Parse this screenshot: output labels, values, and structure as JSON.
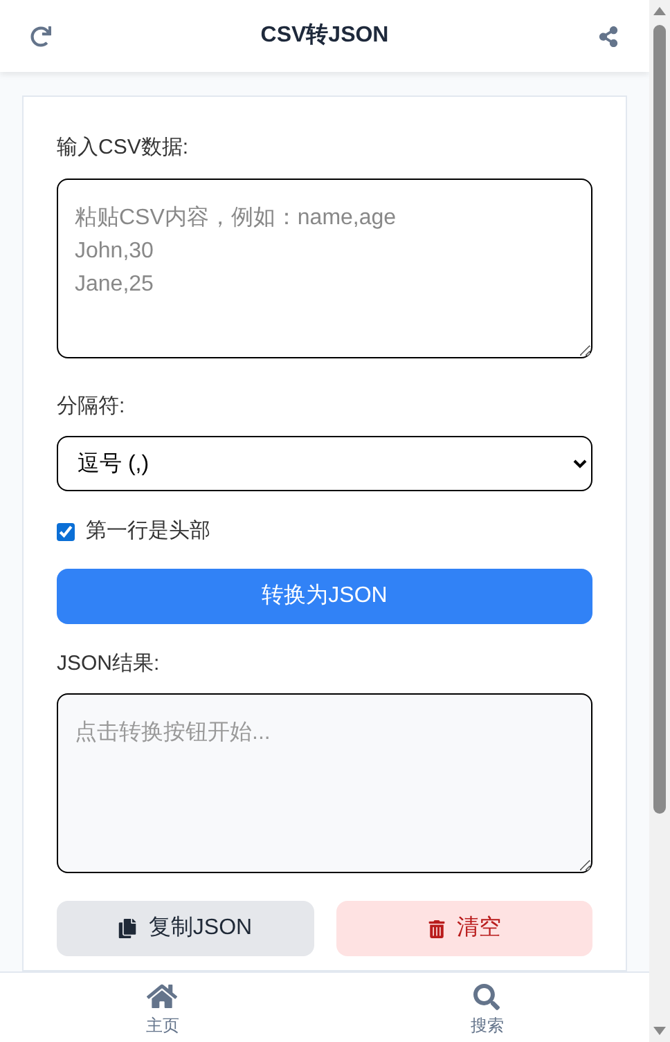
{
  "header": {
    "title": "CSV转JSON"
  },
  "input": {
    "label": "输入CSV数据:",
    "placeholder": "粘贴CSV内容，例如：name,age\nJohn,30\nJane,25"
  },
  "delimiter": {
    "label": "分隔符:",
    "value": "逗号 (,)"
  },
  "header_row": {
    "label": "第一行是头部",
    "checked": true
  },
  "convert_button": "转换为JSON",
  "output": {
    "label": "JSON结果:",
    "placeholder": "点击转换按钮开始..."
  },
  "actions": [
    {
      "kind": "copy",
      "label": "复制JSON"
    },
    {
      "kind": "clear",
      "label": "清空"
    }
  ],
  "nav": [
    {
      "kind": "home",
      "label": "主页"
    },
    {
      "kind": "search",
      "label": "搜索"
    }
  ]
}
